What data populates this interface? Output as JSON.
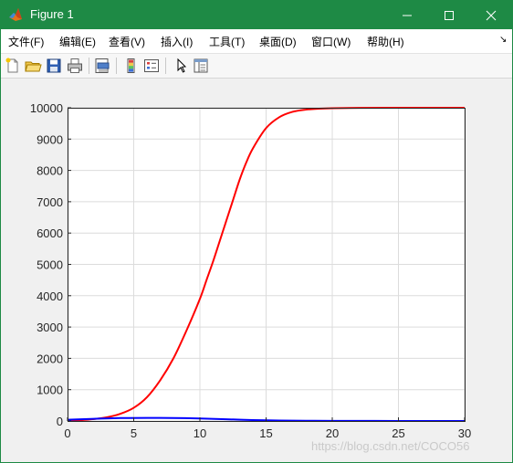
{
  "window": {
    "title": "Figure 1"
  },
  "menu": [
    {
      "label": "文件(F)"
    },
    {
      "label": "编辑(E)"
    },
    {
      "label": "查看(V)"
    },
    {
      "label": "插入(I)"
    },
    {
      "label": "工具(T)"
    },
    {
      "label": "桌面(D)"
    },
    {
      "label": "窗口(W)"
    },
    {
      "label": "帮助(H)"
    }
  ],
  "toolbar": {
    "icons": [
      "new-figure-icon",
      "open-file-icon",
      "save-icon",
      "print-icon",
      "print-preview-icon",
      "colorbar-icon",
      "legend-icon",
      "pointer-icon",
      "property-editor-icon"
    ]
  },
  "chart_data": {
    "type": "line",
    "xlim": [
      0,
      30
    ],
    "ylim": [
      0,
      10000
    ],
    "xticks": [
      "0",
      "5",
      "10",
      "15",
      "20",
      "25",
      "30"
    ],
    "yticks": [
      "0",
      "1000",
      "2000",
      "3000",
      "4000",
      "5000",
      "6000",
      "7000",
      "8000",
      "9000",
      "10000"
    ],
    "grid": true,
    "series": [
      {
        "color": "#ff0000",
        "x": [
          0,
          1,
          2,
          3,
          4,
          5,
          6,
          7,
          8,
          9,
          10,
          10.5,
          11,
          11.5,
          12,
          12.5,
          13,
          13.5,
          14,
          15,
          16,
          17,
          18,
          19,
          20,
          22,
          25,
          30
        ],
        "y": [
          10,
          27,
          60,
          120,
          230,
          420,
          760,
          1300,
          2000,
          2900,
          3900,
          4500,
          5100,
          5750,
          6400,
          7050,
          7700,
          8250,
          8700,
          9350,
          9700,
          9870,
          9940,
          9970,
          9985,
          9995,
          10000,
          10000
        ]
      },
      {
        "color": "#0000ff",
        "x": [
          0,
          2,
          4,
          6,
          8,
          10,
          12,
          14,
          16,
          18,
          20,
          25,
          30
        ],
        "y": [
          40,
          70,
          95,
          100,
          95,
          80,
          55,
          30,
          15,
          8,
          4,
          1,
          0
        ]
      }
    ]
  },
  "watermark": "https://blog.csdn.net/COCO56"
}
